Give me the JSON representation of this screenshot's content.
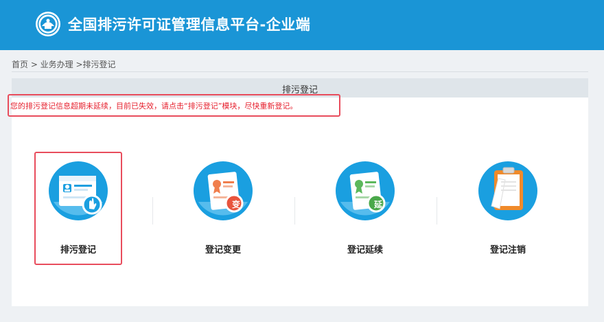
{
  "header": {
    "title": "全国排污许可证管理信息平台-企业端",
    "logo_icon": "environment-logo-icon",
    "background": "#1a95d6"
  },
  "breadcrumb": {
    "text": "首页 > 业务办理 >排污登记"
  },
  "panel": {
    "title": "排污登记"
  },
  "notice": {
    "text": "您的排污登记信息超期未延续，目前已失效，请点击“排污登记”模块，尽快重新登记。",
    "color": "#e6212e"
  },
  "tiles": [
    {
      "label": "排污登记",
      "icon": "registration-card-hand-icon"
    },
    {
      "label": "登记变更",
      "icon": "certificate-change-icon",
      "badge": "变"
    },
    {
      "label": "登记延续",
      "icon": "certificate-extend-icon",
      "badge": "延"
    },
    {
      "label": "登记注销",
      "icon": "clipboard-cancel-icon"
    }
  ],
  "accent": "#1a9fe0",
  "highlight_color": "#e84c5c"
}
